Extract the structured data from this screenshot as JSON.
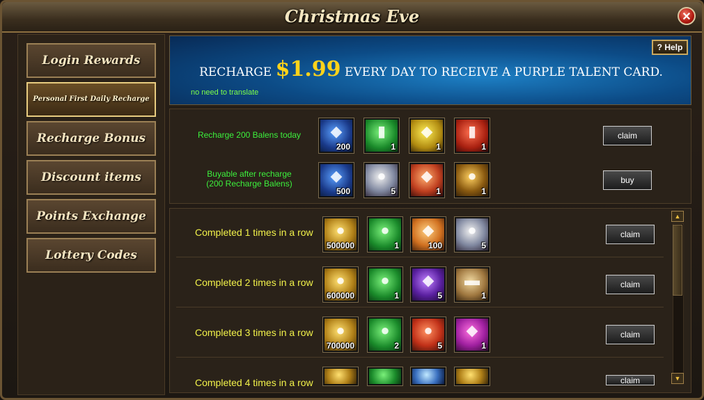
{
  "window": {
    "title": "Christmas Eve",
    "close_glyph": "✕"
  },
  "sidebar": {
    "items": [
      {
        "label": "Login Rewards"
      },
      {
        "label": "Personal First Daily Recharge"
      },
      {
        "label": "Recharge Bonus"
      },
      {
        "label": "Discount items"
      },
      {
        "label": "Points Exchange"
      },
      {
        "label": "Lottery Codes"
      }
    ]
  },
  "banner": {
    "pre": "RECHARGE",
    "amount": "$1.99",
    "post": "EVERY DAY TO RECEIVE A PURPLE TALENT CARD.",
    "note": "no need to translate",
    "help_label": "? Help"
  },
  "top": {
    "rows": [
      {
        "label": "Recharge 200 Balens today",
        "button": "claim",
        "items": [
          {
            "icon": "blue-crystal-icon",
            "qty": "200"
          },
          {
            "icon": "green-ticket-icon",
            "qty": "1"
          },
          {
            "icon": "yellow-gem-icon",
            "qty": "1"
          },
          {
            "icon": "red-card-icon",
            "qty": "1"
          }
        ]
      },
      {
        "label": "Buyable after recharge (200 Recharge Balens)",
        "button": "buy",
        "items": [
          {
            "icon": "blue-crystal-icon",
            "qty": "500"
          },
          {
            "icon": "silver-coin-icon",
            "qty": "5"
          },
          {
            "icon": "red-gem-icon",
            "qty": "1"
          },
          {
            "icon": "potion-icon",
            "qty": "1"
          }
        ]
      }
    ]
  },
  "streak": {
    "rows": [
      {
        "label": "Completed 1 times in a row",
        "button": "claim",
        "items": [
          {
            "icon": "gold-coin-icon",
            "qty": "500000"
          },
          {
            "icon": "green-orb-icon",
            "qty": "1"
          },
          {
            "icon": "orange-crystal-icon",
            "qty": "100"
          },
          {
            "icon": "silver-coin-icon",
            "qty": "5"
          }
        ]
      },
      {
        "label": "Completed 2 times in a row",
        "button": "claim",
        "items": [
          {
            "icon": "gold-coin-icon",
            "qty": "600000"
          },
          {
            "icon": "green-orb-icon",
            "qty": "1"
          },
          {
            "icon": "purple-crystal-icon",
            "qty": "5"
          },
          {
            "icon": "scroll-icon",
            "qty": "1"
          }
        ]
      },
      {
        "label": "Completed 3 times in a row",
        "button": "claim",
        "items": [
          {
            "icon": "gold-coin-icon",
            "qty": "700000"
          },
          {
            "icon": "green-orb-icon",
            "qty": "2"
          },
          {
            "icon": "peach-icon",
            "qty": "5"
          },
          {
            "icon": "magenta-crystal-icon",
            "qty": "1"
          }
        ]
      },
      {
        "label": "Completed 4 times in a row",
        "button": "claim",
        "items": [
          {
            "icon": "gold-coin-icon",
            "qty": ""
          },
          {
            "icon": "green-orb-icon",
            "qty": ""
          },
          {
            "icon": "ice-crystal-icon",
            "qty": ""
          },
          {
            "icon": "gold-gem-icon",
            "qty": ""
          }
        ]
      }
    ]
  },
  "scroll": {
    "up_glyph": "▲",
    "down_glyph": "▼"
  }
}
